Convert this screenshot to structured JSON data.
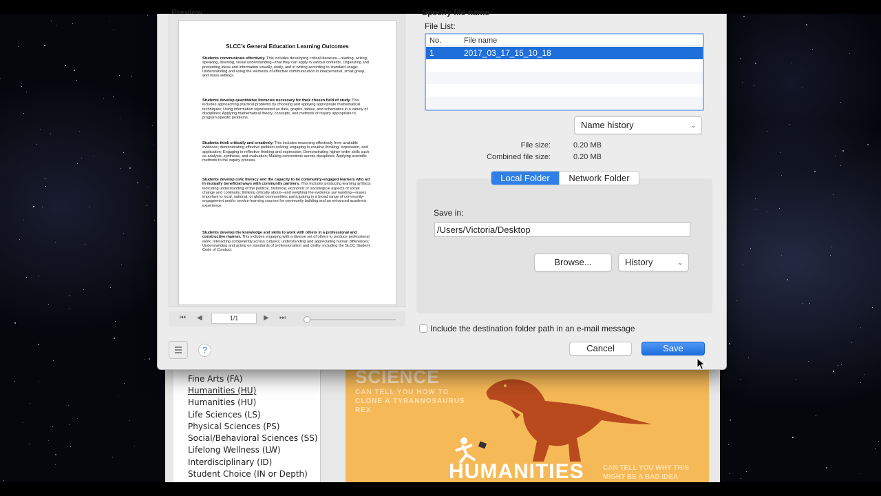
{
  "background_page": {
    "list_items": [
      "Fine Arts (FA)",
      "Humanities (HU)",
      "Humanities (HU)",
      "Life Sciences (LS)",
      "Physical Sciences (PS)",
      "Social/Behavioral Sciences (SS)",
      "Lifelong Wellness (LW)",
      "Interdisciplinary (ID)",
      "Student Choice (IN or Depth)"
    ],
    "poster": {
      "science": "SCIENCE",
      "science_sub": "CAN TELL YOU HOW TO CLONE A TYRANNOSAURUS REX",
      "humanities": "HUMANITIES",
      "humanities_sub": "CAN TELL YOU WHY THIS MIGHT BE A BAD IDEA"
    }
  },
  "dialog": {
    "preview_heading": "Preview",
    "spec_heading": "Specify file name",
    "document": {
      "title": "SLCC's General Education Learning Outcomes",
      "paragraphs": [
        {
          "bold": "Students communicate effectively.",
          "text": " This includes developing critical literacies—reading, writing, speaking, listening, visual understanding—that they can apply in various contexts; Organizing and presenting ideas and information visually, orally, and in writing according to standard usage; Understanding and using the elements of effective communication in interpersonal, small group, and mass settings."
        },
        {
          "bold": "Students develop quantitative literacies necessary for their chosen field of study.",
          "text": " This includes approaching practical problems by choosing and applying appropriate mathematical techniques; Using information represented as data, graphs, tables, and schematics in a variety of disciplines; Applying mathematical theory, concepts, and methods of inquiry appropriate to program-specific problems."
        },
        {
          "bold": "Students think critically and creatively.",
          "text": " This includes reasoning effectively from available evidence; demonstrating effective problem solving; engaging in creative thinking, expression, and application; Engaging in reflective thinking and expression; Demonstrating higher-order skills such as analysis, synthesis, and evaluation; Making connections across disciplines; Applying scientific methods to the inquiry process."
        },
        {
          "bold": "Students develop civic literacy and the capacity to be community-engaged learners who act in mutually beneficial ways with community partners.",
          "text": " This includes producing learning artifacts indicating understanding of the political, historical, economic or sociological aspects of social change and continuity; thinking critically about—and weighing the evidence surrounding—issues important to local, national, or global communities; participating in a broad range of community-engagement and/or service-learning courses for community building and an enhanced academic experience."
        },
        {
          "bold": "Students develop the knowledge and skills to work with others in a professional and constructive manner.",
          "text": " This includes engaging with a diverse set of others to produce professional work; Interacting competently across cultures; understanding and appreciating human differences; Understanding and acting on standards of professionalism and civility, including the SLCC Student Code of Conduct."
        }
      ]
    },
    "pager": {
      "page_value": "1/1",
      "first_icon": "first-page-icon",
      "prev_icon": "prev-page-icon",
      "next_icon": "next-page-icon",
      "last_icon": "last-page-icon"
    },
    "file_list": {
      "label": "File List:",
      "columns": [
        "No.",
        "File name"
      ],
      "rows": [
        {
          "no": "1",
          "name": "2017_03_17_15_10_18"
        }
      ]
    },
    "name_select": "Name history",
    "file_size_label": "File size:",
    "file_size_value": "0.20  MB",
    "combined_size_label": "Combined file size:",
    "combined_size_value": "0.20  MB",
    "tabs": [
      "Local Folder",
      "Network Folder"
    ],
    "save_in_label": "Save in:",
    "save_path": "/Users/Victoria/Desktop",
    "browse_label": "Browse...",
    "history_select": "History",
    "email_label": "Include the destination folder path in an e-mail message",
    "help_label": "?",
    "cancel_label": "Cancel",
    "save_label": "Save",
    "colors": {
      "accent": "#1e6fd9",
      "poster_bg": "#f6b958",
      "dino": "#b94a1e"
    }
  }
}
